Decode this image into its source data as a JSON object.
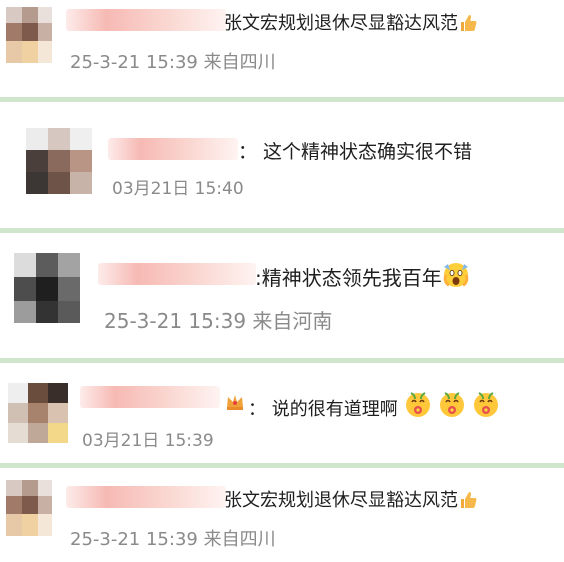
{
  "comments": [
    {
      "text": "张文宏规划退休尽显豁达风范",
      "emoji": "thumbs-up-icon",
      "meta": "25-3-21 15:39 来自四川"
    },
    {
      "text": "： 这个精神状态确实很不错",
      "meta": "03月21日 15:40"
    },
    {
      "text": ":精神状态领先我百年",
      "emoji": "screaming-face-icon",
      "meta": "25-3-21 15:39 来自河南"
    },
    {
      "text": "： 说的很有道理啊",
      "emoji": "kissing-flower-face-icon",
      "meta": "03月21日 15:39"
    },
    {
      "text": "张文宏规划退休尽显豁达风范",
      "emoji": "thumbs-up-icon",
      "meta": "25-3-21 15:39 来自四川"
    }
  ],
  "colors": {
    "separator": "#cfe6cc",
    "meta": "#8a8a8a",
    "name_blur": "#f6b6b0"
  }
}
